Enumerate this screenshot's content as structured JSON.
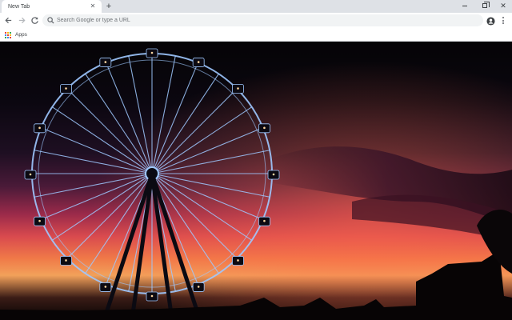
{
  "browser": {
    "tab": {
      "title": "New Tab",
      "close_glyph": "✕"
    },
    "new_tab_glyph": "+",
    "window_close_glyph": "✕"
  },
  "toolbar": {
    "omnibox": {
      "placeholder": "Search Google or type a URL",
      "value": ""
    },
    "icons": [
      "back-arrow-icon",
      "forward-arrow-icon",
      "reload-icon",
      "search-icon",
      "star-icon",
      "profile-icon",
      "menu-icon"
    ],
    "star_glyph": "☆"
  },
  "bookmarks": {
    "apps_label": "Apps",
    "apps_grid_colors": [
      "#ea4335",
      "#fbbc04",
      "#34a853",
      "#4285f4",
      "#ea4335",
      "#fbbc04",
      "#34a853",
      "#4285f4",
      "#ea4335"
    ]
  },
  "background": {
    "subject": "ferris-wheel-silhouette-at-sunset",
    "colors": {
      "sky_top": "#050406",
      "sky_mid": "#9b2a4a",
      "horizon": "#f07a48",
      "wheel_spokes": "#9fc8ff"
    }
  }
}
